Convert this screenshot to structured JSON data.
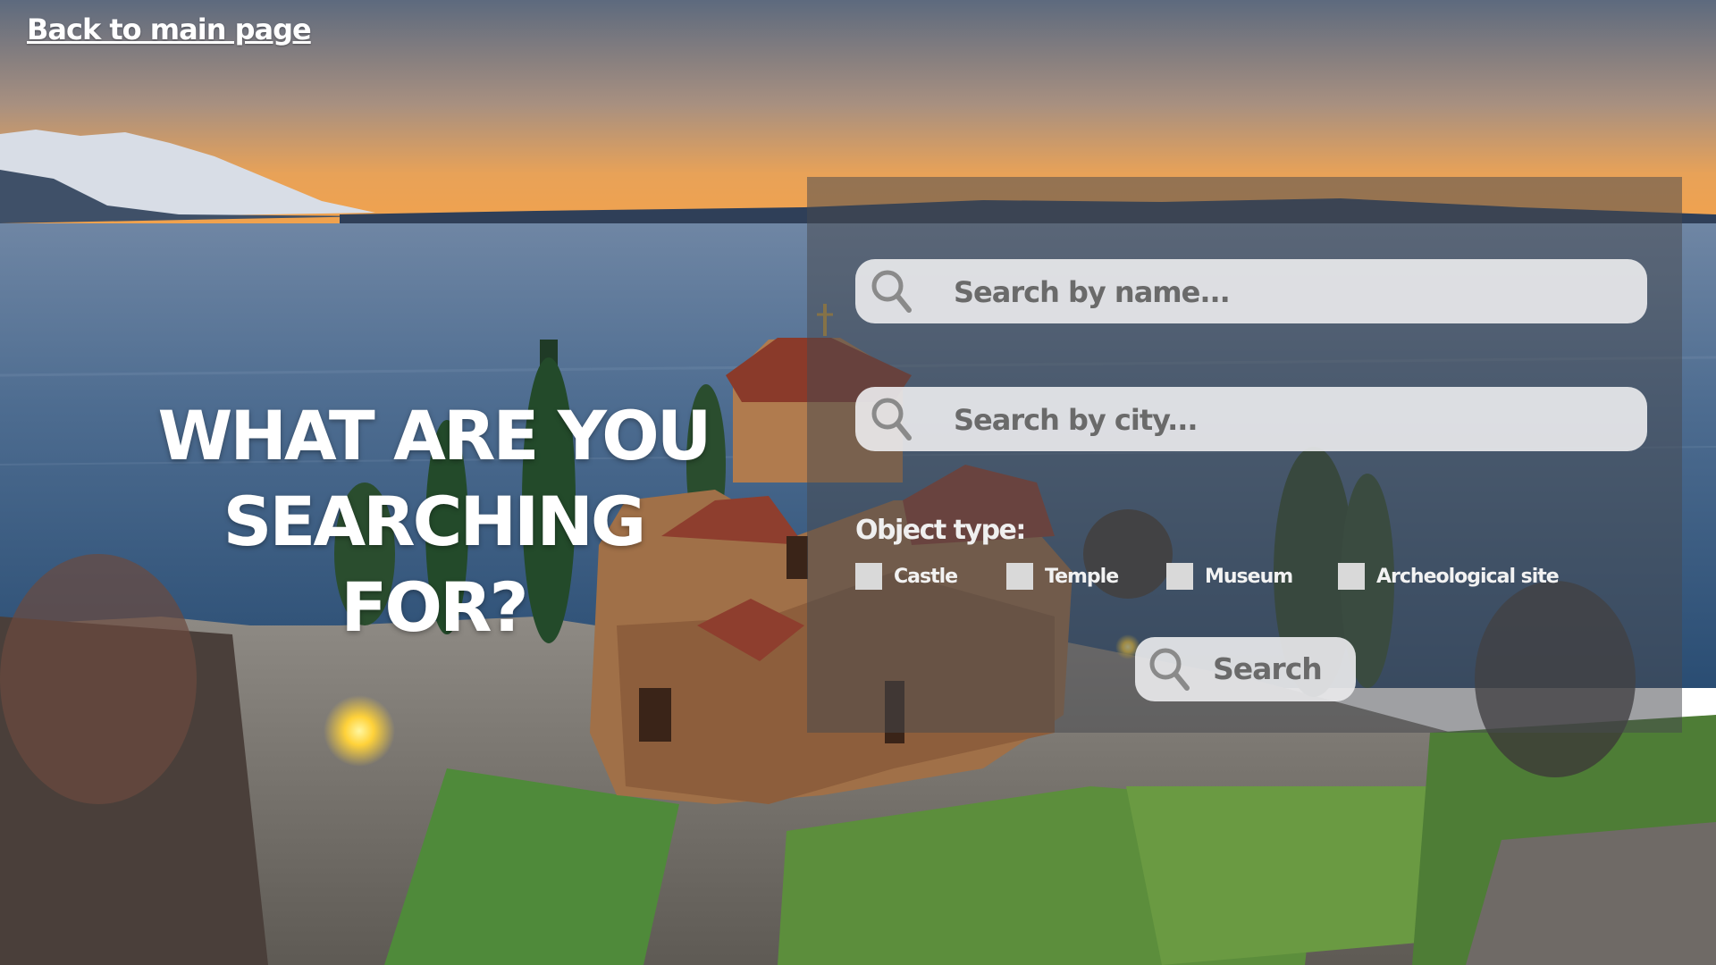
{
  "nav": {
    "back_label": "Back to main page"
  },
  "hero": {
    "title_line1": "WHAT ARE YOU",
    "title_line2": "SEARCHING FOR?"
  },
  "search": {
    "name_placeholder": "Search by name...",
    "city_placeholder": "Search by city...",
    "object_type_label": "Object type:",
    "object_types": [
      "Castle",
      "Temple",
      "Museum",
      "Archeological site"
    ],
    "button_label": "Search",
    "icon": "search-icon"
  },
  "background": {
    "description_icon": "landscape-photo",
    "colors": {
      "sky_top": "#5f6b80",
      "sunset": "#f0a04a",
      "lake": "#3a5f86",
      "panel": "#46484e"
    }
  }
}
